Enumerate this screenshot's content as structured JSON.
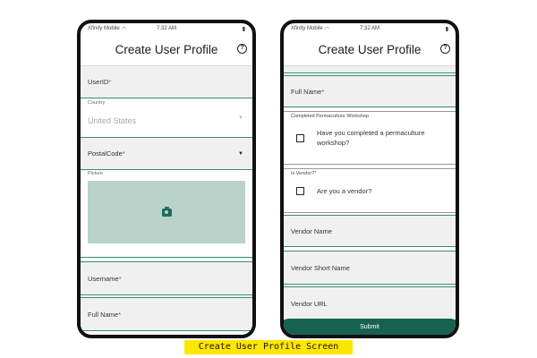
{
  "left_screen": {
    "status": {
      "carrier": "Xfinity Mobile",
      "time": "7:32 AM",
      "battery": "▮"
    },
    "title": "Create User Profile",
    "fields": {
      "userid": {
        "label": "UserID",
        "required": "*"
      },
      "country": {
        "label": "Country",
        "value": "United States"
      },
      "postalcode": {
        "label": "PostalCode",
        "required": "*"
      },
      "picture": {
        "label": "Picture"
      },
      "username": {
        "label": "Username",
        "required": "*"
      },
      "fullname": {
        "label": "Full Name",
        "required": "*"
      }
    }
  },
  "right_screen": {
    "status": {
      "carrier": "Xfinity Mobile",
      "time": "7:32 AM",
      "battery": "▮"
    },
    "title": "Create User Profile",
    "fields": {
      "fullname": {
        "label": "Full Name",
        "required": "*"
      },
      "workshop": {
        "group_label": "Completed Permaculture Workshop",
        "question": "Have you completed a permaculture workshop?"
      },
      "vendor": {
        "group_label": "Is Vendor?",
        "required": "*",
        "question": "Are you a vendor?"
      },
      "vendor_name": {
        "label": "Vendor Name"
      },
      "vendor_short_name": {
        "label": "Vendor Short Name"
      },
      "vendor_url": {
        "label": "Vendor URL"
      }
    },
    "submit_label": "Submit"
  },
  "caption": "Create User Profile Screen",
  "icons": {
    "help": "help-circle-icon",
    "camera": "camera-icon",
    "wifi": "wifi-icon",
    "dropdown": "chevron-down-icon"
  },
  "colors": {
    "accent": "#16624f",
    "picture_bg": "#b9d3ca",
    "required": "#c0392b",
    "caption_bg": "#ffe600"
  }
}
